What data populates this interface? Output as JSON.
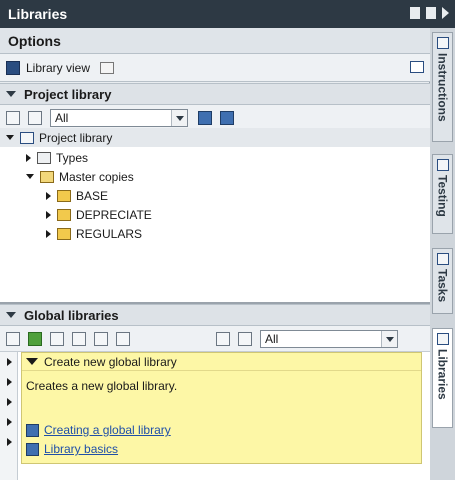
{
  "window": {
    "title": "Libraries"
  },
  "options": {
    "title": "Options",
    "library_view_label": "Library view"
  },
  "project_library": {
    "section_title": "Project library",
    "filter_value": "All",
    "tree": [
      {
        "label": "Project library",
        "level": 0
      },
      {
        "label": "Types",
        "level": 1
      },
      {
        "label": "Master copies",
        "level": 1
      },
      {
        "label": "BASE",
        "level": 2
      },
      {
        "label": "DEPRECIATE",
        "level": 2
      },
      {
        "label": "REGULARS",
        "level": 2
      }
    ]
  },
  "global_libraries": {
    "section_title": "Global libraries",
    "filter_value": "All",
    "info": {
      "title": "Create new global library",
      "description": "Creates a new global library.",
      "links": [
        {
          "label": "Creating a global library"
        },
        {
          "label": "Library basics"
        }
      ]
    }
  },
  "side_tabs": [
    {
      "label": "Instructions"
    },
    {
      "label": "Testing"
    },
    {
      "label": "Tasks"
    },
    {
      "label": "Libraries"
    }
  ]
}
